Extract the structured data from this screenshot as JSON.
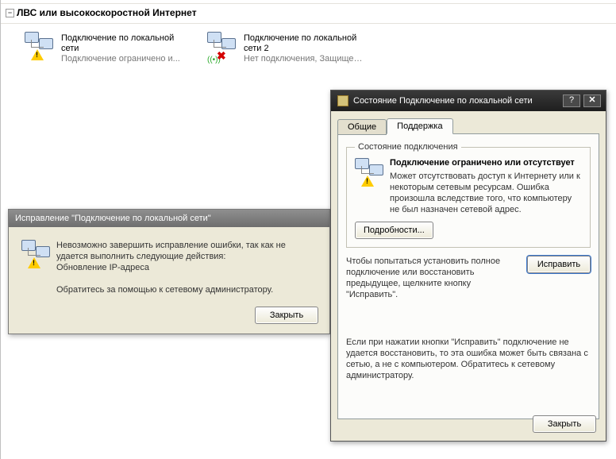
{
  "explorer": {
    "section_title": "ЛВС или высокоскоростной Интернет",
    "connections": [
      {
        "name": "Подключение по локальной сети",
        "status": "Подключение ограничено и...",
        "badge": "warn"
      },
      {
        "name": "Подключение по локальной сети 2",
        "status": "Нет подключения, Защище…",
        "badge": "x"
      }
    ]
  },
  "repair_dialog": {
    "title": "Исправление \"Подключение по локальной сети\"",
    "message_line1": "Невозможно завершить исправление ошибки, так как не удается выполнить следующие действия:",
    "message_line2": "Обновление IP-адреса",
    "message_line3": "Обратитесь за помощью к сетевому администратору.",
    "close_label": "Закрыть"
  },
  "status_dialog": {
    "title": "Состояние Подключение по локальной сети",
    "tabs": {
      "general": "Общие",
      "support": "Поддержка"
    },
    "group": {
      "legend": "Состояние подключения",
      "header": "Подключение ограничено или отсутствует",
      "desc": "Может отсутствовать доступ к Интернету или к некоторым сетевым ресурсам. Ошибка произошла вследствие того, что компьютеру не был назначен сетевой адрес.",
      "details_label": "Подробности..."
    },
    "fix_text": "Чтобы попытаться установить полное подключение или восстановить предыдущее, щелкните кнопку \"Исправить\".",
    "fix_label": "Исправить",
    "note": "Если при нажатии кнопки \"Исправить\" подключение не удается восстановить, то эта ошибка может быть связана с сетью, а не с компьютером. Обратитесь к сетевому администратору.",
    "close_label": "Закрыть"
  }
}
